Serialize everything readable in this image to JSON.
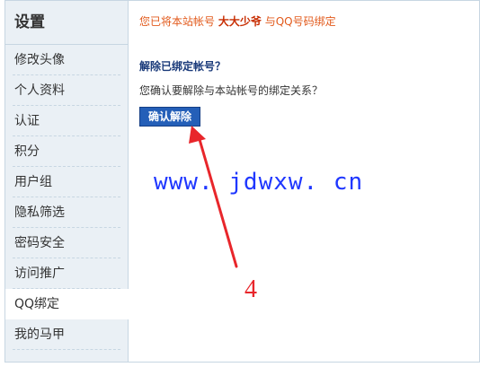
{
  "sidebar": {
    "title": "设置",
    "items": [
      {
        "label": "修改头像",
        "active": false
      },
      {
        "label": "个人资料",
        "active": false
      },
      {
        "label": "认证",
        "active": false
      },
      {
        "label": "积分",
        "active": false
      },
      {
        "label": "用户组",
        "active": false
      },
      {
        "label": "隐私筛选",
        "active": false
      },
      {
        "label": "密码安全",
        "active": false
      },
      {
        "label": "访问推广",
        "active": false
      },
      {
        "label": "QQ绑定",
        "active": true
      },
      {
        "label": "我的马甲",
        "active": false
      }
    ]
  },
  "main": {
    "notice": {
      "prefix": "您已将本站帐号",
      "username": "大大少爷",
      "suffix": "与QQ号码绑定"
    },
    "section_title": "解除已绑定帐号？",
    "confirm_text": "您确认要解除与本站帐号的绑定关系？",
    "confirm_button": "确认解除"
  },
  "annotation": {
    "watermark": "www. jdwxw. cn",
    "step_number": "4",
    "arrow_color": "#e8262b"
  },
  "colors": {
    "sidebar_bg": "#eaf0f5",
    "border": "#c7d6e2",
    "notice": "#e25a1c",
    "button": "#245fb8",
    "watermark": "#1f37ff"
  }
}
